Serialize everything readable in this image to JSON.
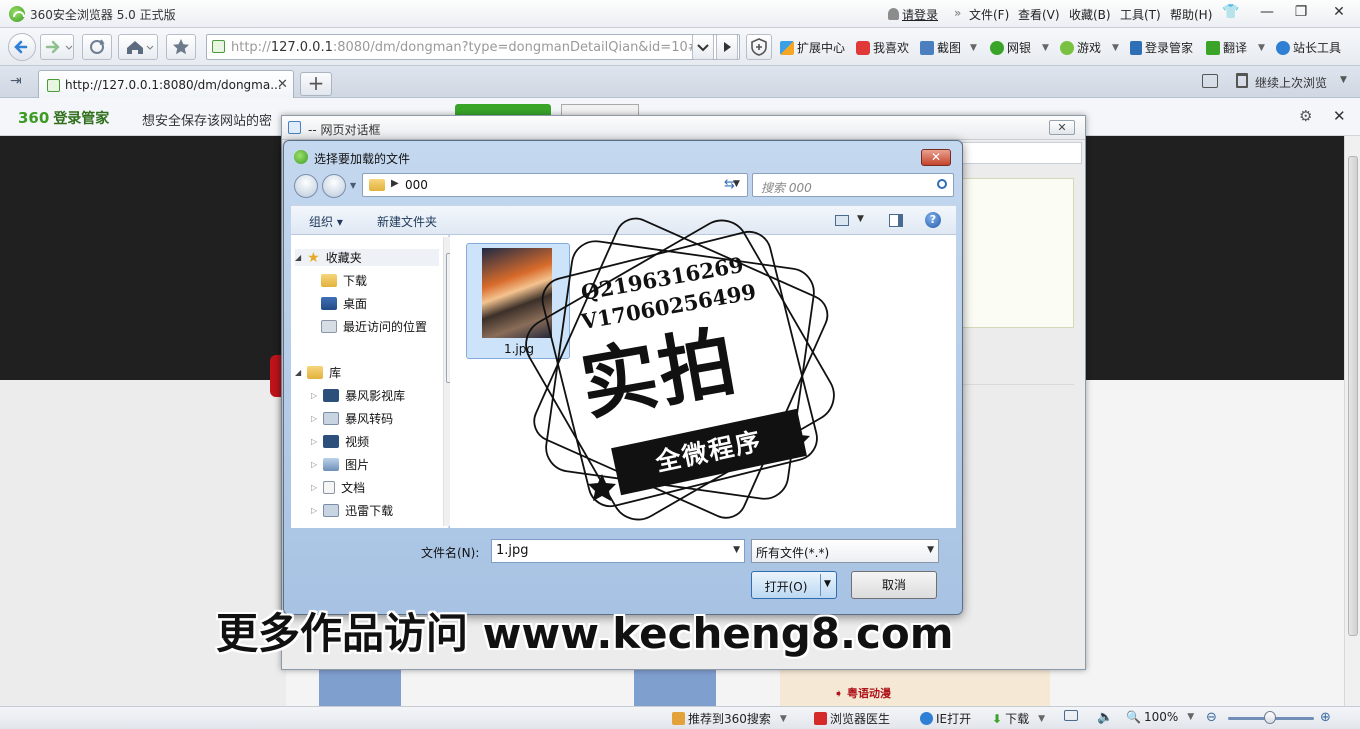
{
  "browser": {
    "title": "360安全浏览器 5.0 正式版",
    "menu": [
      "请登录",
      "文件(F)",
      "查看(V)",
      "收藏(B)",
      "工具(T)",
      "帮助(H)"
    ],
    "url_prefix": "http://",
    "url_host": "127.0.0.1",
    "url_rest": ":8080/dm/dongman?type=dongmanDetailQian&id=10#",
    "toolbar": [
      "扩展中心",
      "我喜欢",
      "截图",
      "网银",
      "游戏",
      "登录管家",
      "翻译",
      "站长工具"
    ],
    "tab_title": "http://127.0.0.1:8080/dm/dongma...",
    "tab_close": "✕",
    "newtab": "+",
    "resume_label": "继续上次浏览",
    "login_brand": "360",
    "login_brand_name": "登录管家",
    "login_msg": "想安全保存该网站的密"
  },
  "statusbar": {
    "items": [
      "推荐到360搜索",
      "浏览器医生",
      "IE打开",
      "下载"
    ],
    "zoom": "100%"
  },
  "page": {
    "category": "粤语动漫"
  },
  "web_dialog": {
    "title": "-- 网页对话框",
    "close": "✕"
  },
  "file_dialog": {
    "title": "选择要加载的文件",
    "close": "✕",
    "breadcrumb": "000",
    "search_placeholder": "搜索 000",
    "commands": [
      "组织 ▾",
      "新建文件夹"
    ],
    "nav": {
      "favorites": "收藏夹",
      "fav_items": [
        "下载",
        "桌面",
        "最近访问的位置"
      ],
      "library": "库",
      "lib_items": [
        "暴风影视库",
        "暴风转码",
        "视频",
        "图片",
        "文档",
        "迅雷下载"
      ]
    },
    "file": {
      "name": "1.jpg"
    },
    "filename_label": "文件名(N):",
    "filename_value": "1.jpg",
    "filetype": "所有文件(*.*)",
    "open_label": "打开(O)",
    "cancel_label": "取消"
  },
  "watermark": {
    "qq": "Q2196316269",
    "wechat": "V17060256499",
    "big": "实拍",
    "ribbon": "全微程序",
    "site": "更多作品访问 www.kecheng8.com"
  },
  "colors": {
    "accent": "#3b9b23",
    "dialog_frame": "#a7c2e3",
    "close_red": "#c3442c",
    "category_red": "#b0141b"
  }
}
